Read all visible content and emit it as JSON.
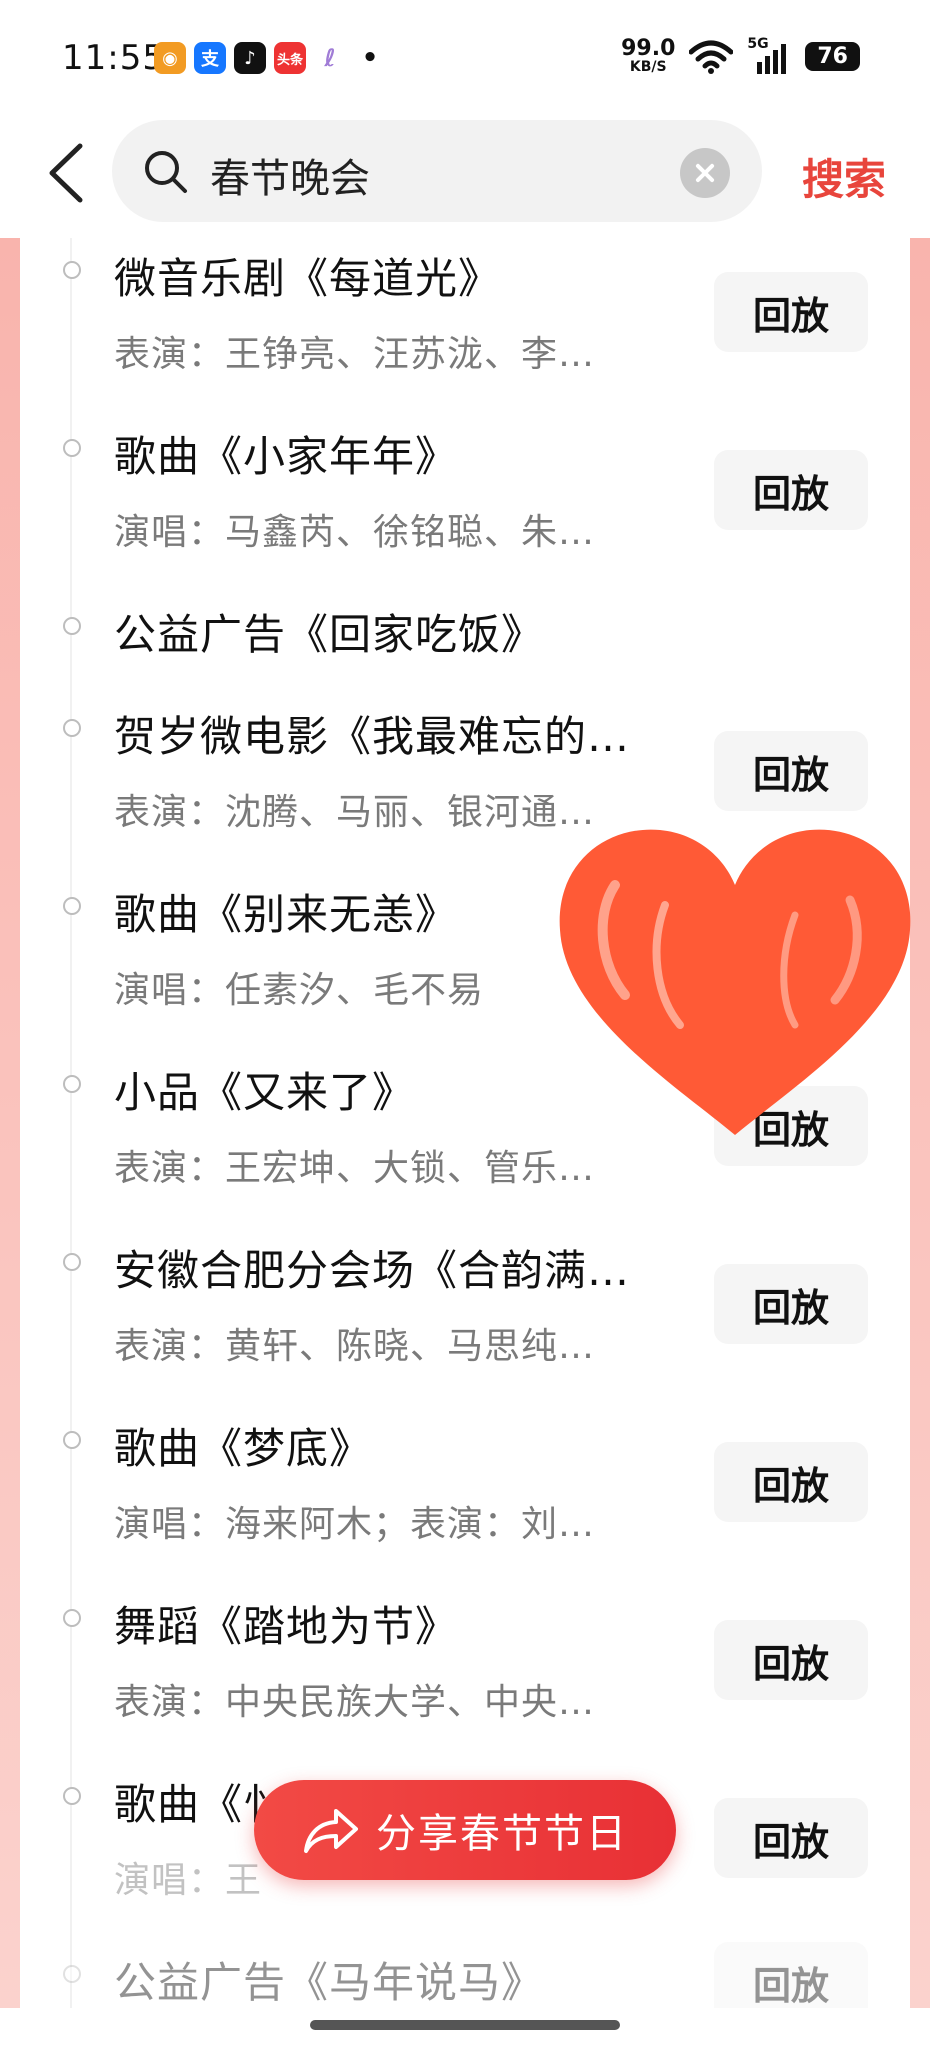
{
  "status_bar": {
    "time": "11:55",
    "net_speed_value": "99.0",
    "net_speed_unit": "KB/S",
    "signal_label": "5G",
    "battery": "76",
    "app_icons": [
      "weibo-icon",
      "alipay-icon",
      "tiktok-icon",
      "toutiao-icon",
      "app-icon",
      "dot-icon"
    ],
    "app_glyphs": [
      "",
      "支",
      "♪",
      "头条",
      "ℓ",
      "•"
    ]
  },
  "search": {
    "query": "春节晚会",
    "button_label": "搜索"
  },
  "program_list": [
    {
      "title": "微音乐剧《每道光》",
      "subtitle": "表演：王铮亮、汪苏泷、李…",
      "replay": "回放"
    },
    {
      "title": "歌曲《小家年年》",
      "subtitle": "演唱：马鑫芮、徐铭聪、朱…",
      "replay": "回放"
    },
    {
      "title": "公益广告《回家吃饭》",
      "subtitle": "",
      "replay": ""
    },
    {
      "title": "贺岁微电影《我最难忘的…",
      "subtitle": "表演：沈腾、马丽、银河通…",
      "replay": "回放"
    },
    {
      "title": "歌曲《别来无恙》",
      "subtitle": "演唱：任素汐、毛不易",
      "replay": ""
    },
    {
      "title": "小品《又来了》",
      "subtitle": "表演：王宏坤、大锁、管乐…",
      "replay": "回放"
    },
    {
      "title": "安徽合肥分会场《合韵满…",
      "subtitle": "表演：黄轩、陈晓、马思纯…",
      "replay": "回放"
    },
    {
      "title": "歌曲《梦底》",
      "subtitle": "演唱：海来阿木；表演：刘…",
      "replay": "回放"
    },
    {
      "title": "舞蹈《踏地为节》",
      "subtitle": "表演：中央民族大学、中央…",
      "replay": "回放"
    },
    {
      "title": "歌曲《忄",
      "subtitle": "演唱：王",
      "replay": "回放"
    },
    {
      "title": "公益广告《马年说马》",
      "subtitle": "",
      "replay": "回放"
    }
  ],
  "share_button": {
    "label": "分享春节节日"
  },
  "colors": {
    "accent": "#e8453c",
    "frame": "#f9b4ad",
    "heart": "#ff5a36"
  }
}
